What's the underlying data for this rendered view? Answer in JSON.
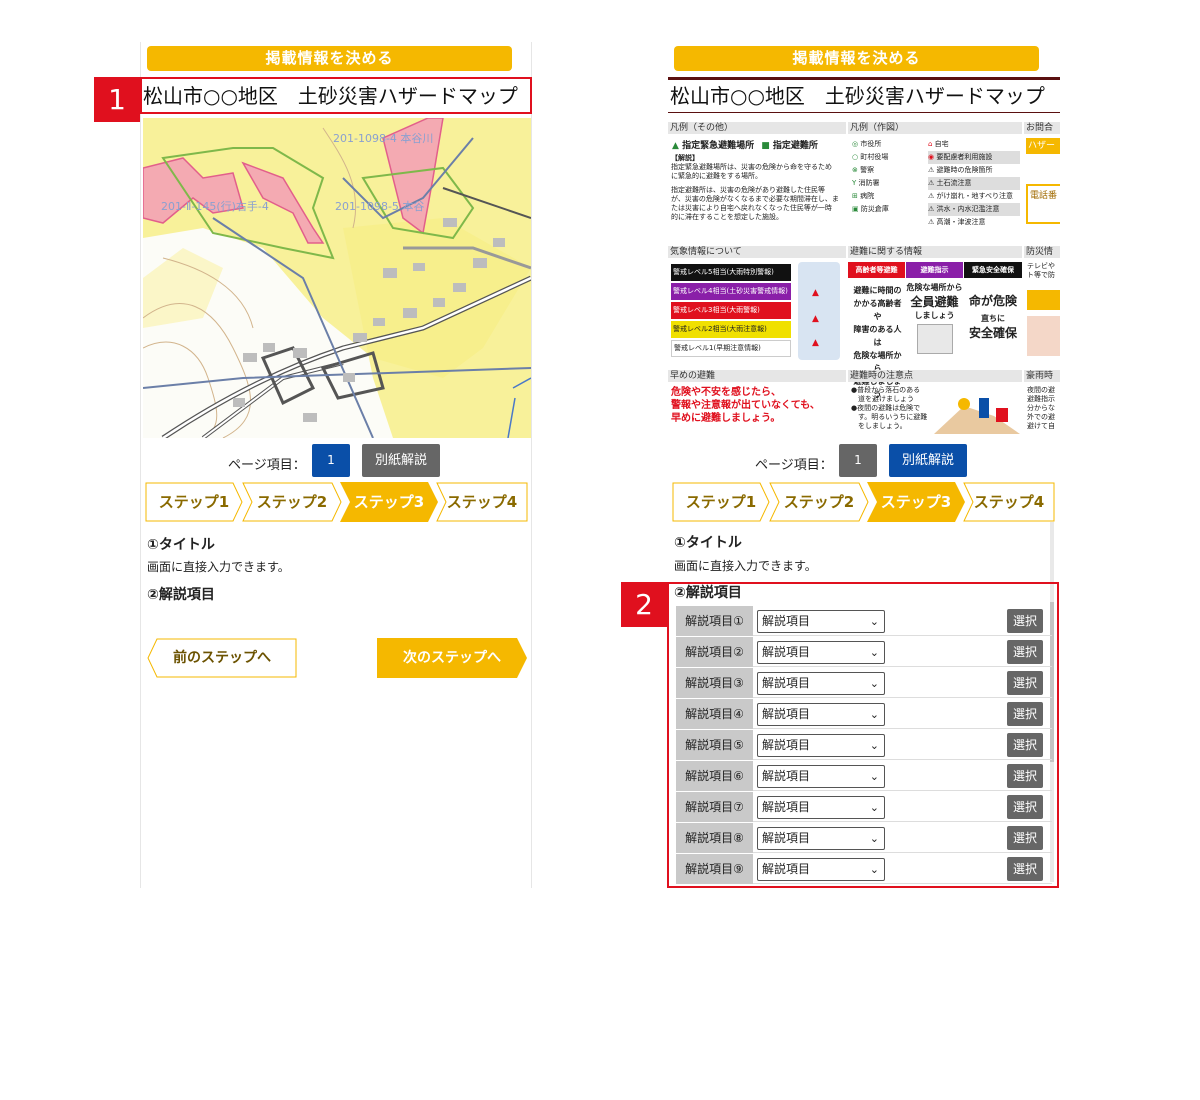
{
  "left": {
    "header": "掲載情報を決める",
    "title": "松山市○○地区　土砂災害ハザードマップ",
    "callout": "1",
    "map_labels": [
      "201-1098-4 本谷川",
      "201-Ⅱ-145(行)右手-4",
      "201-1098-5 本谷"
    ],
    "page_label": "ページ項目：",
    "page_number": "1",
    "separate_button": "別紙解説",
    "steps": [
      "ステップ1",
      "ステップ2",
      "ステップ3",
      "ステップ4"
    ],
    "active_step": 2,
    "section1_title": "①タイトル",
    "section1_text": "画面に直接入力できます。",
    "section2_title": "②解説項目",
    "prev_button": "前のステップへ",
    "next_button": "次のステップへ"
  },
  "right": {
    "header": "掲載情報を決める",
    "title": "松山市○○地区　土砂災害ハザードマップ",
    "callout": "2",
    "poster": {
      "legend_other": "凡例（その他）",
      "emergency_site": "指定緊急避難場所",
      "shelter": "指定避難所",
      "explain_head": "【解説】",
      "explain_lines": [
        "指定緊急避難場所は、災害の危険から命を守るため",
        "に緊急的に避難をする場所。",
        "指定避難所は、災害の危険があり避難した住民等",
        "が、災害の危険がなくなるまで必要な期間滞在し、ま",
        "たは災害により自宅へ戻れなくなった住民等が一時",
        "的に滞在することを想定した施設。"
      ],
      "legend_map": "凡例（作図）",
      "legend_map_items": [
        "市役所",
        "町村役場",
        "警察",
        "消防署",
        "病院",
        "防災倉庫"
      ],
      "legend_map_items2": [
        "自宅",
        "要配慮者利用施設",
        "避難時の危険箇所",
        "土石流注意",
        "がけ崩れ・地すべり注意",
        "洪水・内水氾濫注意",
        "高潮・津波注意"
      ],
      "contact": "お問合",
      "hazard_label": "ハザー",
      "phone_label": "電話番",
      "weather": "気象情報について",
      "weather_levels": [
        "警戒レベル5相当(大雨特別警報)",
        "警戒レベル4相当(土砂災害警戒情報)",
        "警戒レベル3相当(大雨警報)",
        "警戒レベル2相当(大雨注意報)",
        "警戒レベル1(早期注意情報)"
      ],
      "evac_info": "避難に関する情報",
      "evac_heads": [
        "高齢者等避難",
        "避難指示",
        "緊急安全確保"
      ],
      "evac_col1": [
        "避難に時間の",
        "かかる高齢者や",
        "障害のある人は",
        "危険な場所から",
        "避難しましょう"
      ],
      "evac_col2_a": "危険な場所から",
      "evac_col2_b": "全員避難",
      "evac_col2_c": "しましょう",
      "evac_col3_a": "命が危険",
      "evac_col3_b": "直ちに",
      "evac_col3_c": "安全確保",
      "disaster_info": "防災情",
      "tv_text": "テレビや",
      "tv_text2": "ト等で防",
      "early": "早めの避難",
      "early_lines": [
        "危険や不安を感じたら、",
        "警報や注意報が出ていなくても、",
        "早めに避難しましょう。"
      ],
      "caution": "避難時の注意点",
      "caution_lines": [
        "●普段から落石のある",
        "　道を避けましょう",
        "●夜間の避難は危険で",
        "　す。明るいうちに避難",
        "　をしましょう。"
      ],
      "heavy_rain": "豪雨時",
      "heavy_lines": [
        "夜間の避",
        "避難指示",
        "分からな",
        "外での避",
        "避けて自"
      ]
    },
    "page_label": "ページ項目：",
    "page_number": "1",
    "separate_button": "別紙解説",
    "steps": [
      "ステップ1",
      "ステップ2",
      "ステップ3",
      "ステップ4"
    ],
    "active_step": 2,
    "section1_title": "①タイトル",
    "section1_text": "画面に直接入力できます。",
    "section2_title": "②解説項目",
    "items": [
      {
        "label": "解説項目①",
        "value": "解説項目",
        "button": "選択"
      },
      {
        "label": "解説項目②",
        "value": "解説項目",
        "button": "選択"
      },
      {
        "label": "解説項目③",
        "value": "解説項目",
        "button": "選択"
      },
      {
        "label": "解説項目④",
        "value": "解説項目",
        "button": "選択"
      },
      {
        "label": "解説項目⑤",
        "value": "解説項目",
        "button": "選択"
      },
      {
        "label": "解説項目⑥",
        "value": "解説項目",
        "button": "選択"
      },
      {
        "label": "解説項目⑦",
        "value": "解説項目",
        "button": "選択"
      },
      {
        "label": "解説項目⑧",
        "value": "解説項目",
        "button": "選択"
      },
      {
        "label": "解説項目⑨",
        "value": "解説項目",
        "button": "選択"
      }
    ]
  },
  "colors": {
    "accent": "#f5b800",
    "callout": "#e0101e",
    "blue": "#0a4fa8",
    "gray": "#666666"
  }
}
